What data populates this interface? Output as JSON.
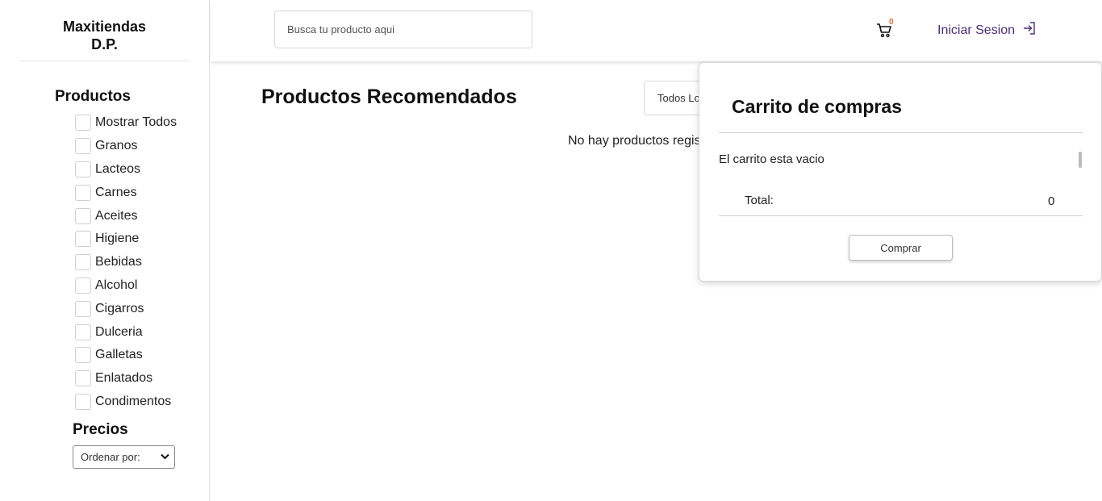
{
  "brand": {
    "line1": "Maxitiendas",
    "line2": "D.P."
  },
  "sidebar": {
    "categories_title": "Productos",
    "categories": [
      "Mostrar Todos",
      "Granos",
      "Lacteos",
      "Carnes",
      "Aceites",
      "Higiene",
      "Bebidas",
      "Alcohol",
      "Cigarros",
      "Dulceria",
      "Galletas",
      "Enlatados",
      "Condimentos"
    ],
    "price_title": "Precios",
    "price_select_value": "Ordenar por:"
  },
  "header": {
    "search_placeholder": "Busca tu producto aqui",
    "cart_count": "0",
    "login_label": "Iniciar Sesion"
  },
  "main": {
    "title": "Productos Recomendados",
    "filter_value": "Todos Los Productos",
    "empty_message": "No hay productos registrados"
  },
  "cart": {
    "title": "Carrito de compras",
    "empty_text": "El carrito esta vacio",
    "total_label": "Total:",
    "total_value": "0",
    "buy_label": "Comprar"
  },
  "colors": {
    "accent": "#4b2e83",
    "badge": "#e86b2a"
  }
}
